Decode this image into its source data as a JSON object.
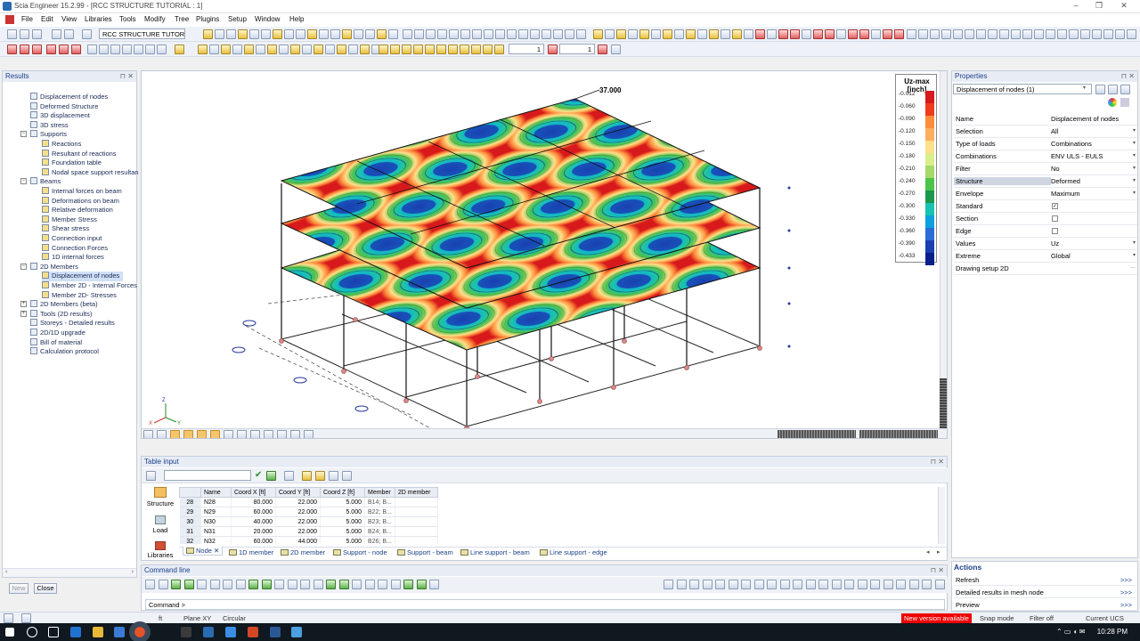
{
  "window": {
    "title": "Scia Engineer 15.2.99 - [RCC STRUCTURE TUTORIAL : 1]",
    "controls": [
      "–",
      "❐",
      "✕"
    ]
  },
  "menu": [
    "File",
    "Edit",
    "View",
    "Libraries",
    "Tools",
    "Modify",
    "Tree",
    "Plugins",
    "Setup",
    "Window",
    "Help"
  ],
  "toolbar": {
    "project_combo": "RCC STRUCTURE TUTORIAL",
    "spin1": "1",
    "spin2": "1"
  },
  "results_panel": {
    "title": "Results",
    "items": [
      {
        "label": "Displacement of nodes",
        "level": 0
      },
      {
        "label": "Deformed Structure",
        "level": 0
      },
      {
        "label": "3D displacement",
        "level": 0
      },
      {
        "label": "3D stress",
        "level": 0
      },
      {
        "label": "Supports",
        "level": 0,
        "group": true
      },
      {
        "label": "Reactions",
        "level": 1
      },
      {
        "label": "Resultant of reactions",
        "level": 1
      },
      {
        "label": "Foundation table",
        "level": 1
      },
      {
        "label": "Nodal space support resultan",
        "level": 1
      },
      {
        "label": "Beams",
        "level": 0,
        "group": true
      },
      {
        "label": "Internal forces on beam",
        "level": 1
      },
      {
        "label": "Deformations on beam",
        "level": 1
      },
      {
        "label": "Relative deformation",
        "level": 1
      },
      {
        "label": "Member Stress",
        "level": 1
      },
      {
        "label": "Shear stress",
        "level": 1
      },
      {
        "label": "Connection input",
        "level": 1
      },
      {
        "label": "Connection Forces",
        "level": 1
      },
      {
        "label": "1D internal forces",
        "level": 1
      },
      {
        "label": "2D Members",
        "level": 0,
        "group": true
      },
      {
        "label": "Displacement of nodes",
        "level": 1,
        "selected": true
      },
      {
        "label": "Member 2D - Internal Forces",
        "level": 1
      },
      {
        "label": "Member 2D- Stresses",
        "level": 1
      },
      {
        "label": "2D Members (beta)",
        "level": 0,
        "group": true,
        "collapsed": true
      },
      {
        "label": "Tools (2D results)",
        "level": 0,
        "group": true,
        "collapsed": true
      },
      {
        "label": "Storeys - Detailed results",
        "level": 0
      },
      {
        "label": "2D/1D upgrade",
        "level": 0
      },
      {
        "label": "Bill of material",
        "level": 0
      },
      {
        "label": "Calculation protocol",
        "level": 0
      }
    ],
    "new_label": "New",
    "close_label": "Close"
  },
  "viewport": {
    "max_label": "37.000",
    "legend": {
      "title": "Uz-max [inch]",
      "values": [
        "-0.012",
        "-0.060",
        "-0.090",
        "-0.120",
        "-0.150",
        "-0.180",
        "-0.210",
        "-0.240",
        "-0.270",
        "-0.300",
        "-0.330",
        "-0.360",
        "-0.390",
        "-0.433"
      ],
      "colors": [
        "#d7191c",
        "#f03b20",
        "#fd8d3c",
        "#fdae61",
        "#fee08b",
        "#d9ef8b",
        "#a6d96a",
        "#4cc44c",
        "#1a9850",
        "#17c3b2",
        "#0fa0e0",
        "#2b6cd8",
        "#1a3fb0",
        "#0a1f8a"
      ]
    },
    "axis_labels": {
      "z": "Z",
      "x": "X",
      "y": "Y"
    }
  },
  "properties": {
    "title": "Properties",
    "selector": "Displacement of nodes (1)",
    "rows": [
      {
        "key": "Name",
        "value": "Displacement of nodes"
      },
      {
        "key": "Selection",
        "value": "All",
        "dropdown": true
      },
      {
        "key": "Type of loads",
        "value": "Combinations",
        "dropdown": true
      },
      {
        "key": "Combinations",
        "value": "ENV ULS - EULS",
        "dropdown": true
      },
      {
        "key": "Filter",
        "value": "No",
        "dropdown": true
      },
      {
        "key": "Structure",
        "value": "Deformed",
        "dropdown": true,
        "highlight": true
      },
      {
        "key": "Envelope",
        "value": "Maximum",
        "dropdown": true
      },
      {
        "key": "Standard",
        "checkbox": true,
        "checked": true
      },
      {
        "key": "Section",
        "checkbox": true,
        "checked": false
      },
      {
        "key": "Edge",
        "checkbox": true,
        "checked": false
      },
      {
        "key": "Values",
        "value": "Uz",
        "dropdown": true
      },
      {
        "key": "Extreme",
        "value": "Global",
        "dropdown": true
      },
      {
        "key": "Drawing setup 2D",
        "value": "",
        "ellipsis": true
      }
    ]
  },
  "actions": {
    "title": "Actions",
    "items": [
      "Refresh",
      "Detailed results in mesh node",
      "Preview"
    ],
    "more": ">>>"
  },
  "table_input": {
    "title": "Table input",
    "side_buttons": [
      "Structure",
      "Load",
      "Libraries"
    ],
    "columns": [
      "",
      "Name",
      "Coord X [ft]",
      "Coord Y [ft]",
      "Coord Z [ft]",
      "Member",
      "2D member"
    ],
    "rows": [
      [
        "28",
        "N28",
        "80.000",
        "22.000",
        "5.000",
        "B14; B...",
        ""
      ],
      [
        "29",
        "N29",
        "60.000",
        "22.000",
        "5.000",
        "B22; B...",
        ""
      ],
      [
        "30",
        "N30",
        "40.000",
        "22.000",
        "5.000",
        "B23; B...",
        ""
      ],
      [
        "31",
        "N31",
        "20.000",
        "22.000",
        "5.000",
        "B24; B...",
        ""
      ],
      [
        "32",
        "N32",
        "60.000",
        "44.000",
        "5.000",
        "B26; B...",
        ""
      ]
    ],
    "tabs": [
      "Node",
      "1D member",
      "2D member",
      "Support - node",
      "Support - beam",
      "Line support - beam",
      "Line support - edge"
    ]
  },
  "command_line": {
    "title": "Command line",
    "prompt": "Command >"
  },
  "status": {
    "unit": "ft",
    "plane": "Plane XY",
    "mode": "Circular",
    "new_version": "New version available",
    "snap": "Snap mode",
    "filter": "Filter off",
    "ucs": "Current UCS"
  },
  "taskbar": {
    "time": "10:28 PM"
  }
}
